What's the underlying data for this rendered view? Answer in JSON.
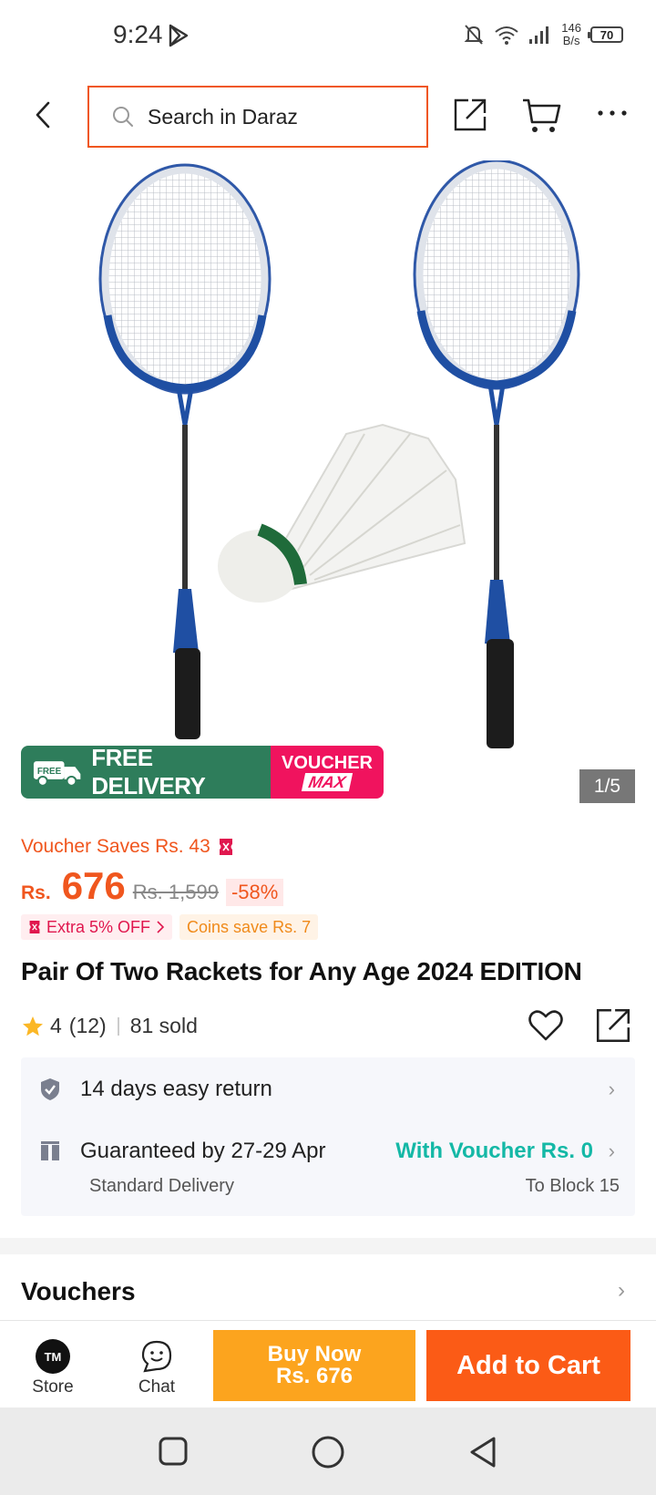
{
  "status_bar": {
    "time": "9:24",
    "net_speed_value": "146",
    "net_speed_unit": "B/s",
    "battery": "70"
  },
  "header": {
    "search_placeholder": "Search in Daraz"
  },
  "gallery": {
    "counter": "1/5",
    "promo_free_badge": "FREE",
    "promo_free_text": "FREE DELIVERY",
    "promo_voucher_line1": "VOUCHER",
    "promo_voucher_line2": "MAX"
  },
  "price": {
    "voucher_saves": "Voucher Saves Rs. 43",
    "currency": "Rs.",
    "current": "676",
    "original": "Rs. 1,599",
    "discount": "-58%",
    "extra_off": "Extra 5% OFF",
    "coins_save": "Coins save Rs. 7"
  },
  "product": {
    "title": "Pair Of Two Rackets for Any Age 2024 EDITION",
    "rating": "4",
    "reviews": "(12)",
    "sold": "81 sold"
  },
  "services": {
    "return_text": "14 days easy return",
    "delivery_text": "Guaranteed by 27-29 Apr",
    "delivery_voucher": "With Voucher Rs. 0",
    "delivery_type": "Standard Delivery",
    "delivery_location": "To Block 15"
  },
  "vouchers": {
    "title": "Vouchers"
  },
  "action_bar": {
    "store_label": "Store",
    "store_logo": "TM",
    "chat_label": "Chat",
    "buy_now_line1": "Buy Now",
    "buy_now_line2": "Rs. 676",
    "add_to_cart": "Add to Cart"
  },
  "colors": {
    "brand_orange": "#f0561e",
    "buy_now": "#fca41e",
    "add_to_cart": "#fb5b16",
    "free_delivery": "#2e7d5b",
    "voucher_max": "#f0135e",
    "voucher_teal": "#14b8a6"
  }
}
